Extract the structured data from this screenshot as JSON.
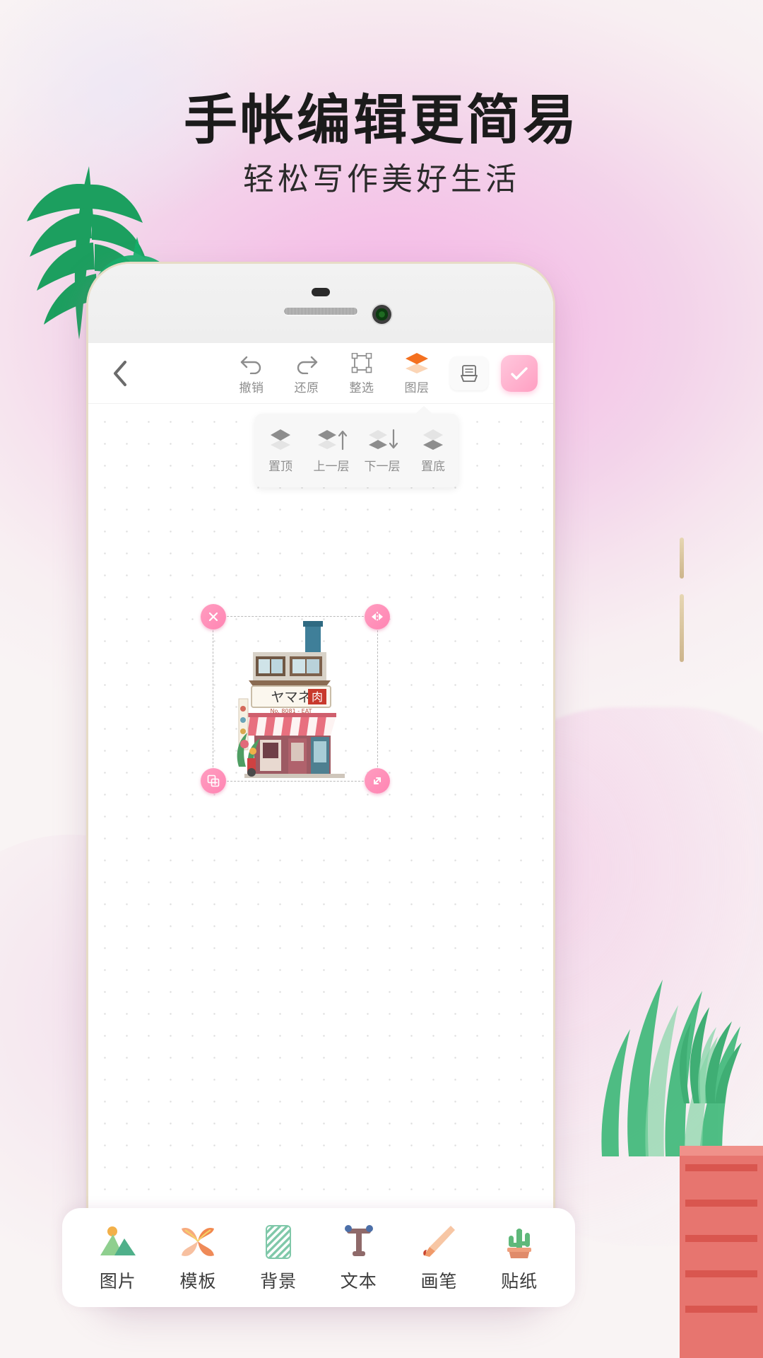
{
  "poster": {
    "headline": "手帐编辑更简易",
    "subhead": "轻松写作美好生活"
  },
  "colors": {
    "accent_pink": "#ff9fc2",
    "accent_orange": "#f4701f",
    "label_gray": "#8d8d8d",
    "dock_label": "#3c3c3c"
  },
  "app": {
    "topbar": {
      "back_icon": "chevron-left-icon",
      "tools": [
        {
          "label": "撤销",
          "icon": "undo-icon",
          "active": false
        },
        {
          "label": "还原",
          "icon": "redo-icon",
          "active": false
        },
        {
          "label": "整选",
          "icon": "select-frame-icon",
          "active": false
        },
        {
          "label": "图层",
          "icon": "layers-icon",
          "active": true
        }
      ],
      "save_icon": "save-card-icon",
      "done_icon": "check-icon"
    },
    "layer_menu": {
      "items": [
        {
          "label": "置顶",
          "icon": "layer-front-icon"
        },
        {
          "label": "上一层",
          "icon": "layer-up-icon"
        },
        {
          "label": "下一层",
          "icon": "layer-down-icon"
        },
        {
          "label": "置底",
          "icon": "layer-back-icon"
        }
      ]
    },
    "canvas": {
      "selection": {
        "handles": [
          {
            "name": "delete-handle",
            "icon": "close-icon"
          },
          {
            "name": "flip-handle",
            "icon": "flip-horizontal-icon"
          },
          {
            "name": "copy-handle",
            "icon": "duplicate-icon"
          },
          {
            "name": "resize-handle",
            "icon": "resize-arrow-icon"
          }
        ],
        "sticker_name": "japanese-shop-sticker",
        "sticker_sign_text": "ヤマネ肉店"
      }
    },
    "dock": {
      "items": [
        {
          "label": "图片",
          "icon": "image-icon"
        },
        {
          "label": "模板",
          "icon": "template-flower-icon"
        },
        {
          "label": "背景",
          "icon": "background-pattern-icon"
        },
        {
          "label": "文本",
          "icon": "text-tool-icon"
        },
        {
          "label": "画笔",
          "icon": "brush-icon"
        },
        {
          "label": "贴纸",
          "icon": "sticker-cactus-icon"
        }
      ]
    }
  }
}
